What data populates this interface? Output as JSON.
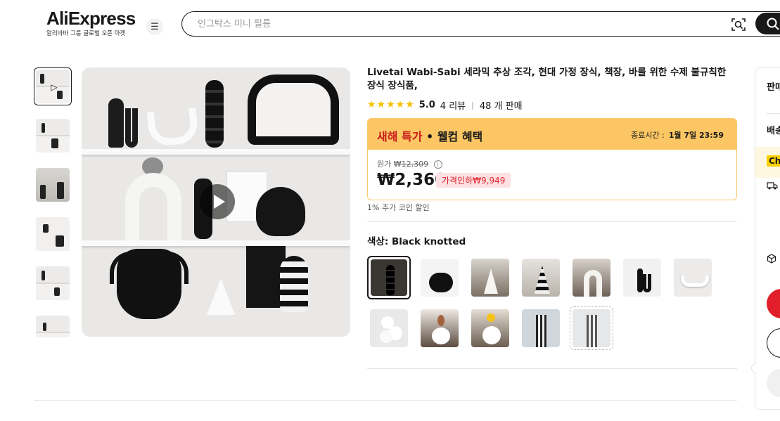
{
  "header": {
    "logo_text": "AliExpress",
    "logo_sub": "알리바바 그룹 글로벌 오픈 마켓",
    "search_placeholder": "인그탁스 미니 필름"
  },
  "product": {
    "title": "Livetai Wabi-Sabi 세라믹 추상 조각, 현대 가정 장식, 책장, 바를 위한 수제 불규칙한 장식 장식품,",
    "rating_score": "5.0",
    "reviews": "4 리뷰",
    "sold": "48 개 판매",
    "stars_count": 5
  },
  "deal": {
    "title_red": "새해 특가",
    "title_rest": " • 웰컴 혜택",
    "end_label": "종료시간 :",
    "end_time": "1월 7일 23:59",
    "orig_label": "원가",
    "orig_price": "₩12,309",
    "price": "₩2,360",
    "discount": "가격인하₩9,949",
    "coin": "1% 추가 코인 할인"
  },
  "color": {
    "label": "색상: Black knotted",
    "selected_index": 0,
    "option_count": 12
  },
  "right_panel": {
    "title1": "판매",
    "title2": "배송",
    "choice": "Ch"
  },
  "colors": {
    "brand_red": "#e01f2a",
    "deal_yellow": "#fcc664",
    "star": "#f6c000"
  }
}
